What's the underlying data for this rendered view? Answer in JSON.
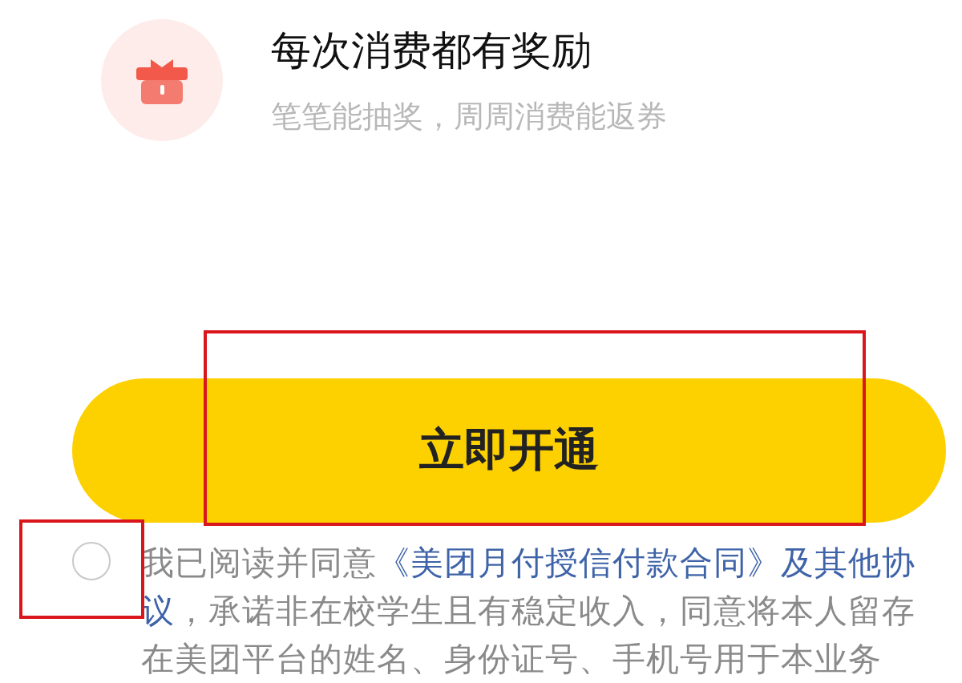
{
  "feature": {
    "title": "每次消费都有奖励",
    "subtitle": "笔笔能抽奖，周周消费能返券"
  },
  "primary_button": {
    "label": "立即开通",
    "highlighted": true
  },
  "agreement": {
    "checked": false,
    "checkbox_highlighted": true,
    "prefix": "我已阅读并同意",
    "link_parts": [
      "《美团月付授信付款合同》及其他协",
      "议"
    ],
    "suffix": "，承诺非在校学生且有稳定收入，同意将本人留存在美团平台的姓名、身份证号、手机号用于本业务"
  }
}
